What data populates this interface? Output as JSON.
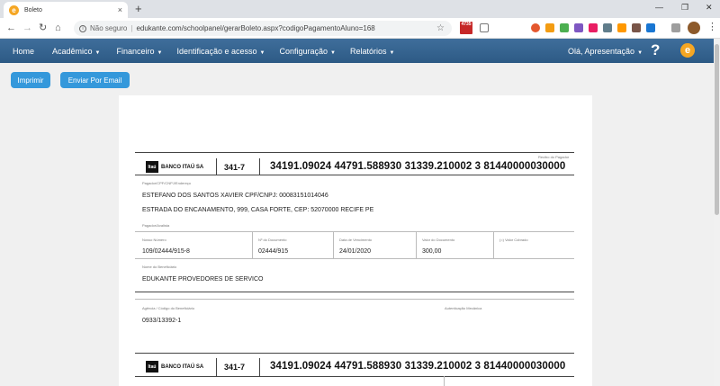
{
  "browser": {
    "tab_title": "Boleto",
    "tab_close": "×",
    "new_tab": "+",
    "favicon_letter": "e",
    "secure_label": "Não seguro",
    "url": "edukante.com/schoolpanel/gerarBoleto.aspx?codigoPagamentoAluno=168",
    "ext_badge": "4735",
    "window_controls": [
      "—",
      "❐",
      "✕"
    ],
    "nav_icons": [
      "back-icon",
      "forward-icon",
      "reload-icon",
      "home-icon"
    ]
  },
  "navbar": {
    "items": [
      {
        "label": "Home",
        "caret": false
      },
      {
        "label": "Acadêmico",
        "caret": true
      },
      {
        "label": "Financeiro",
        "caret": true
      },
      {
        "label": "Identificação e acesso",
        "caret": true
      },
      {
        "label": "Configuração",
        "caret": true
      },
      {
        "label": "Relatórios",
        "caret": true
      }
    ],
    "user": "Olá, Apresentação",
    "help": "?",
    "logo_letter": "e",
    "accent": "#2d5a85"
  },
  "actions": {
    "print_label": "Imprimir",
    "email_label": "Enviar Por Email",
    "button_color": "#3498db"
  },
  "boleto": {
    "recibo_label": "Recibo do Pagador",
    "bank_logo": "Itaú",
    "bank_name": "BANCO ITAÚ SA",
    "bank_code": "341-7",
    "digitable_line": "34191.09024  44791.588930  31339.210002  3  81440000030000",
    "pagador_label": "Pagador/CPF/CNPJ/Endereço",
    "pagador_name": "ESTEFANO DOS SANTOS XAVIER  CPF/CNPJ: 00083151014046",
    "pagador_address": "ESTRADA DO ENCANAMENTO,  999, CASA FORTE, CEP: 52070000 RECIFE PE",
    "avalista_label": "Pagador/Avalista",
    "nosso_numero_label": "Nosso Número",
    "nosso_numero": "109/02444/915-8",
    "numero_documento_label": "Nº do Documento",
    "numero_documento": "02444/915",
    "vencimento_label": "Data de Vencimento",
    "vencimento": "24/01/2020",
    "valor_documento_label": "Valor do Documento",
    "valor_documento": "300,00",
    "valor_cobrado_label": "(=) Valor Cobrado",
    "beneficiario_label": "Nome do Beneficiário",
    "beneficiario": "EDUKANTE PROVEDORES DE SERVICO",
    "agencia_label": "Agência / Código do Beneficiário",
    "agencia": "0933/13392-1",
    "autenticacao_label": "Autenticação Mecânica"
  }
}
